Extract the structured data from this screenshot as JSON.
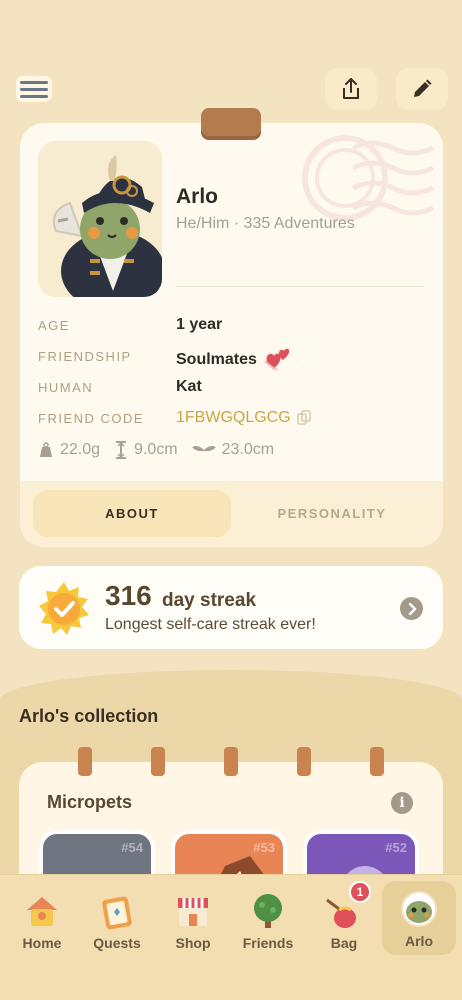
{
  "header": {
    "menu_icon": "hamburger-menu-icon",
    "share_icon": "share-icon",
    "edit_icon": "pencil-icon"
  },
  "profile": {
    "name": "Arlo",
    "pronouns_adventures": "He/Him · 335 Adventures",
    "fields": {
      "age_label": "AGE",
      "age_value": "1 year",
      "friendship_label": "FRIENDSHIP",
      "friendship_value": "Soulmates",
      "human_label": "HUMAN",
      "human_value": "Kat",
      "friend_code_label": "FRIEND CODE",
      "friend_code_value": "1FBWGQLGCG"
    },
    "metrics": {
      "weight": "22.0g",
      "height": "9.0cm",
      "wingspan": "23.0cm"
    },
    "tabs": {
      "about": "ABOUT",
      "personality": "PERSONALITY"
    }
  },
  "streak": {
    "number": "316",
    "word": "day streak",
    "subtitle": "Longest self-care streak ever!"
  },
  "collection": {
    "title": "Arlo's collection",
    "micropets_title": "Micropets",
    "pets": [
      {
        "num": "#54",
        "color": "#6e7580"
      },
      {
        "num": "#53",
        "color": "#e98555"
      },
      {
        "num": "#52",
        "color": "#7a57b8"
      }
    ]
  },
  "nav": {
    "items": [
      {
        "label": "Home"
      },
      {
        "label": "Quests"
      },
      {
        "label": "Shop"
      },
      {
        "label": "Friends"
      },
      {
        "label": "Bag",
        "badge": "1"
      },
      {
        "label": "Arlo"
      }
    ]
  },
  "colors": {
    "background": "#f3e3c0",
    "card": "#fffaf0",
    "accent_gold": "#c8a544",
    "badge_red": "#e0505a"
  }
}
